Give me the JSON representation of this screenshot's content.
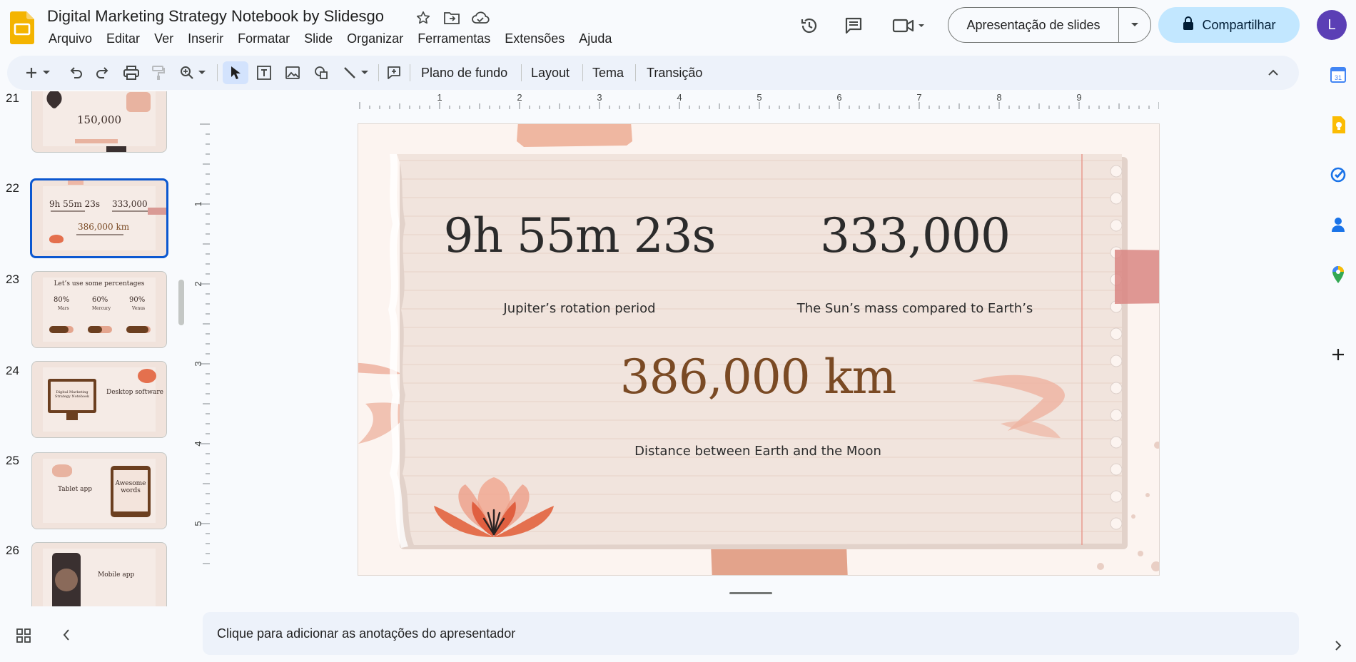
{
  "app": {
    "title": "Digital Marketing Strategy Notebook by Slidesgo",
    "menu": [
      "Arquivo",
      "Editar",
      "Ver",
      "Inserir",
      "Formatar",
      "Slide",
      "Organizar",
      "Ferramentas",
      "Extensões",
      "Ajuda"
    ],
    "slideshow_label": "Apresentação de slides",
    "share_label": "Compartilhar",
    "avatar_letter": "L"
  },
  "toolbar": {
    "background_label": "Plano de fundo",
    "layout_label": "Layout",
    "theme_label": "Tema",
    "transition_label": "Transição"
  },
  "ruler": {
    "h_ticks": [
      "1",
      "2",
      "3",
      "4",
      "5",
      "6",
      "7",
      "8",
      "9"
    ],
    "v_ticks": [
      "1",
      "2",
      "3",
      "4",
      "5"
    ]
  },
  "filmstrip": [
    {
      "num": "21",
      "title": "150,000"
    },
    {
      "num": "22",
      "a": "9h 55m 23s",
      "b": "333,000",
      "c": "386,000 km",
      "selected": true
    },
    {
      "num": "23",
      "title": "Let’s use some percentages",
      "p1": "80%",
      "p2": "60%",
      "p3": "90%",
      "l1": "Mars",
      "l2": "Mercury",
      "l3": "Venus"
    },
    {
      "num": "24",
      "title": "Desktop software",
      "screen": "Digital Marketing Strategy Notebook"
    },
    {
      "num": "25",
      "title": "Tablet app",
      "screen": "Awesome words"
    },
    {
      "num": "26",
      "title": "Mobile app"
    }
  ],
  "slide": {
    "stat1_value": "9h 55m 23s",
    "stat1_label": "Jupiter’s rotation period",
    "stat2_value": "333,000",
    "stat2_label": "The Sun’s mass compared to Earth’s",
    "stat3_value": "386,000 km",
    "stat3_label": "Distance between Earth and the Moon"
  },
  "notes_placeholder": "Clique para adicionar as anotações do apresentador",
  "colors": {
    "accent_blue": "#0b57d0",
    "share_bg": "#c2e7ff",
    "stat_dark": "#2b2b2b",
    "stat_brown": "#7a4a24",
    "slides_yellow": "#f4b400"
  }
}
